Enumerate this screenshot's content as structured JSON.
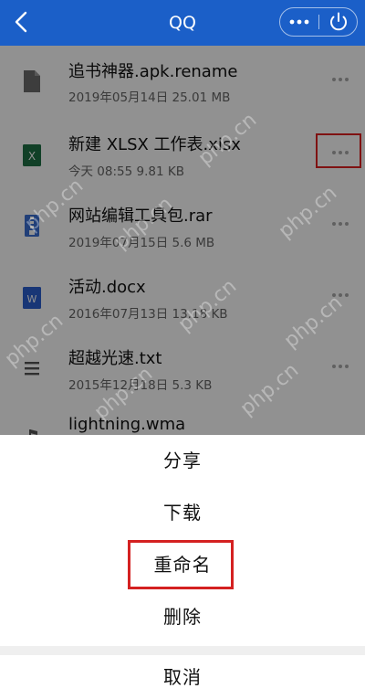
{
  "header": {
    "title": "QQ",
    "back_icon": "chevron-left-icon",
    "more_icon": "ellipsis-icon",
    "power_icon": "power-icon"
  },
  "files": [
    {
      "name": "追书神器.apk.rename",
      "meta": "2019年05月14日 25.01 MB",
      "icon": "generic-file-icon",
      "icon_color": "#6b6b6b"
    },
    {
      "name": "新建 XLSX 工作表.xlsx",
      "meta": "今天 08:55 9.81 KB",
      "icon": "excel-file-icon",
      "icon_color": "#1e7145"
    },
    {
      "name": "网站编辑工具包.rar",
      "meta": "2019年07月15日 5.6 MB",
      "icon": "archive-file-icon",
      "icon_color": "#3b6fd4"
    },
    {
      "name": "活动.docx",
      "meta": "2016年07月13日 13.18 KB",
      "icon": "word-file-icon",
      "icon_color": "#2b5fd0"
    },
    {
      "name": "超越光速.txt",
      "meta": "2015年12月18日 5.3 KB",
      "icon": "text-file-icon",
      "icon_color": "#555555"
    },
    {
      "name": "lightning.wma",
      "meta": "",
      "icon": "audio-file-icon",
      "icon_color": "#555555"
    }
  ],
  "actions": {
    "share": "分享",
    "download": "下载",
    "rename": "重命名",
    "delete": "删除",
    "cancel": "取消"
  },
  "watermark": "php.cn",
  "colors": {
    "header_bg": "#1b5fc8",
    "highlight": "#e02020",
    "overlay": "rgba(0,0,0,0.43)"
  }
}
